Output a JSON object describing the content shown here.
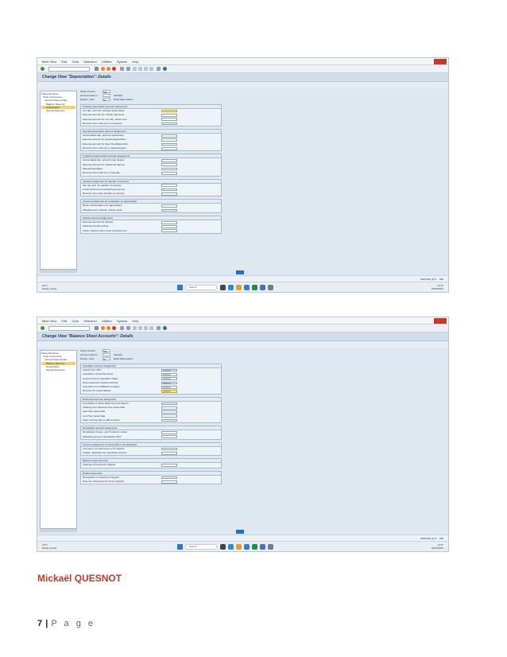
{
  "menu": [
    "Table View",
    "Edit",
    "Goto",
    "Selection",
    "Utilities",
    "System",
    "Help"
  ],
  "screens": [
    {
      "title": "Change View \"Depreciation\": Details",
      "tree": {
        "header": "Dialog Structure",
        "items": [
          "Chart of Accounts",
          "Account Determinatio",
          "Balance Sheet Ac",
          "Depreciation",
          "Special Reserves"
        ],
        "selected": 3
      },
      "header_rows": [
        {
          "label": "Chart of Accts",
          "value": "INT",
          "text": "..."
        },
        {
          "label": "Account Determ.",
          "value": "",
          "text": "Vehicles"
        },
        {
          "label": "Deprec. area",
          "value": "01",
          "text": "Book Depreciation"
        }
      ],
      "groups": [
        {
          "title": "Ordinary depreciation account assignment",
          "rows": [
            {
              "label": "Acc.dep. accnt.for ordinary depreciation",
              "value": "",
              "highlight": true
            },
            {
              "label": "Expense account for ordinary depreciat",
              "value": ""
            },
            {
              "label": "Expense account for ord. dep. below zero",
              "value": ""
            },
            {
              "label": "Revenue from write-up on ord.deprec.",
              "value": ""
            }
          ]
        },
        {
          "title": "Special depreciation account assignment",
          "rows": [
            {
              "label": "Accumulated dep. account special dep.",
              "value": ""
            },
            {
              "label": "Expense account for special depreciation",
              "value": ""
            },
            {
              "label": "Expense account for Spec.Dep.Below Zero",
              "value": ""
            },
            {
              "label": "Revenue from write-up on special deprec.",
              "value": ""
            }
          ]
        },
        {
          "title": "Unplanned depreciation account assignment",
          "rows": [
            {
              "label": "Accumulated dep. account unpl. deprec.",
              "value": ""
            },
            {
              "label": "Expense account for unplanned depreci.",
              "value": ""
            },
            {
              "label": "Manual deprciation",
              "value": ""
            },
            {
              "label": "Revenue from write-up on unpl.dep.",
              "value": ""
            }
          ]
        },
        {
          "title": "Account assignment for transfer of reserves",
          "rows": [
            {
              "label": "Val. adj. acct. for transfer of reserves",
              "value": ""
            },
            {
              "label": "Contra account for transferring reserves",
              "value": ""
            },
            {
              "label": "Revenue from w/up transfer of reserves",
              "value": ""
            }
          ]
        },
        {
          "title": "Account assignment for revaluation on depreciation",
          "rows": [
            {
              "label": "Reval. accumulated ord. depreciation",
              "value": ""
            },
            {
              "label": "Offsetting acct.fr.Reval. ordinary depr.",
              "value": ""
            }
          ]
        },
        {
          "title": "Interest account assignment",
          "rows": [
            {
              "label": "Expense account for interest",
              "value": ""
            },
            {
              "label": "Clearing interest posting",
              "value": ""
            },
            {
              "label": "Imput. expense when book val below zero",
              "value": ""
            }
          ]
        }
      ],
      "status_right": "SAP(x02) (1) ▾  ...  INS"
    },
    {
      "title": "Change View \"Balance Sheet Accounts\": Details",
      "tree": {
        "header": "Dialog Structure",
        "items": [
          "Chart of Accounts",
          "Account Determinatio",
          "Balance Sheet Ac",
          "Depreciation",
          "Special Reserves"
        ],
        "selected": 2
      },
      "header_rows": [
        {
          "label": "Chart of Accts",
          "value": "INT",
          "text": "..."
        },
        {
          "label": "Account Determ.",
          "value": "",
          "text": "Vehicles"
        },
        {
          "label": "Deprec. area",
          "value": "01",
          "text": "Book Depreciation"
        }
      ],
      "groups": [
        {
          "title": "Acquisition account assignment",
          "rows": [
            {
              "label": "Acqstn:Acct: APC",
              "value": "0000000"
            },
            {
              "label": "Acquisition: Down Payments",
              "value": "0000000"
            },
            {
              "label": "Contra Account: Acquisition Value",
              "value": "0000000"
            },
            {
              "label": "Down-payments clearing account",
              "value": "0000000"
            },
            {
              "label": "Acquisition from affiliated company",
              "value": "0000000"
            },
            {
              "label": "Revenue for asset balance",
              "value": "0000000",
              "highlight": true
            }
          ]
        },
        {
          "title": "Retirement account assignment",
          "rows": [
            {
              "label": "Loss Made on Asset Retirement w/o Reven.",
              "value": ""
            },
            {
              "label": "Clearing Acct. Revenue from Asset Sale",
              "value": ""
            },
            {
              "label": "Gain from Asset Sale",
              "value": ""
            },
            {
              "label": "Loss from Asset Sale",
              "value": ""
            },
            {
              "label": "Clear.revenue sale to affil.company",
              "value": ""
            }
          ]
        },
        {
          "title": "Revaluation account assignment",
          "rows": [
            {
              "label": "Revaluation Acquis. and Production Costs",
              "value": ""
            },
            {
              "label": "Offsetting Account: Revaluation APC",
              "value": ""
            }
          ]
        },
        {
          "title": "Account assignment of cost portions not capitalized",
          "rows": [
            {
              "label": "Cost elem. for settmt.exp.to CO objects",
              "value": ""
            },
            {
              "label": "Capital. offsetting from operating expense",
              "value": ""
            }
          ]
        },
        {
          "title": "Balance sheet accounts",
          "rows": [
            {
              "label": "Clearing of Investment Support",
              "value": ""
            }
          ]
        },
        {
          "title": "Deferred accounts",
          "rows": [
            {
              "label": "Recognition of Investment Support",
              "value": ""
            },
            {
              "label": "Expense: Repayment of Invest.Support",
              "value": ""
            }
          ]
        }
      ],
      "status_right": "SAP(x02) (1) ▾  ...  INS"
    }
  ],
  "taskbar": {
    "weather_temp": "14°C",
    "weather_desc": "Mostly cloudy",
    "search_label": "Search",
    "tray_time": "12:47",
    "tray_date": "02/05/2024"
  },
  "author": "Mickaël QUESNOT",
  "page": {
    "number": "7",
    "separator": "|",
    "label": "P a g e"
  }
}
